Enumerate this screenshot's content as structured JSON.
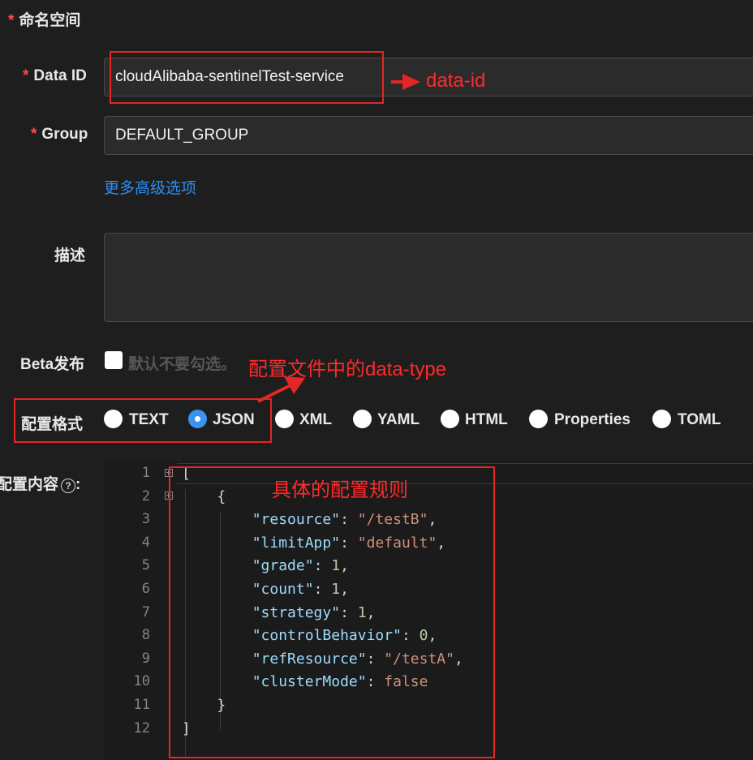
{
  "form": {
    "namespace": {
      "required": "*",
      "label": "命名空间"
    },
    "data_id": {
      "required": "*",
      "label": "Data ID",
      "value": "cloudAlibaba-sentinelTest-service"
    },
    "group": {
      "required": "*",
      "label": "Group",
      "value": "DEFAULT_GROUP"
    },
    "advanced_link": "更多高级选项",
    "description": {
      "label": "描述",
      "value": ""
    },
    "beta": {
      "label": "Beta发布",
      "hint": "默认不要勾选。",
      "checked": false
    },
    "format": {
      "label": "配置格式",
      "selected": "JSON",
      "options": [
        "TEXT",
        "JSON",
        "XML",
        "YAML",
        "HTML",
        "Properties",
        "TOML"
      ]
    },
    "content": {
      "label": "配置内容",
      "help_icon": "question-circle-icon",
      "colon": ":"
    }
  },
  "editor": {
    "line_numbers": [
      "1",
      "2",
      "3",
      "4",
      "5",
      "6",
      "7",
      "8",
      "9",
      "10",
      "11",
      "12"
    ],
    "lines": [
      {
        "indent": "",
        "parts": [
          {
            "t": "p",
            "v": "["
          }
        ]
      },
      {
        "indent": "    ",
        "parts": [
          {
            "t": "p",
            "v": "{"
          }
        ]
      },
      {
        "indent": "        ",
        "parts": [
          {
            "t": "k",
            "v": "\"resource\""
          },
          {
            "t": "p",
            "v": ": "
          },
          {
            "t": "s",
            "v": "\"/testB\""
          },
          {
            "t": "p",
            "v": ","
          }
        ]
      },
      {
        "indent": "        ",
        "parts": [
          {
            "t": "k",
            "v": "\"limitApp\""
          },
          {
            "t": "p",
            "v": ": "
          },
          {
            "t": "s",
            "v": "\"default\""
          },
          {
            "t": "p",
            "v": ","
          }
        ]
      },
      {
        "indent": "        ",
        "parts": [
          {
            "t": "k",
            "v": "\"grade\""
          },
          {
            "t": "p",
            "v": ": "
          },
          {
            "t": "n",
            "v": "1"
          },
          {
            "t": "p",
            "v": ","
          }
        ]
      },
      {
        "indent": "        ",
        "parts": [
          {
            "t": "k",
            "v": "\"count\""
          },
          {
            "t": "p",
            "v": ": "
          },
          {
            "t": "n",
            "v": "1"
          },
          {
            "t": "p",
            "v": ","
          }
        ]
      },
      {
        "indent": "        ",
        "parts": [
          {
            "t": "k",
            "v": "\"strategy\""
          },
          {
            "t": "p",
            "v": ": "
          },
          {
            "t": "n",
            "v": "1"
          },
          {
            "t": "p",
            "v": ","
          }
        ]
      },
      {
        "indent": "        ",
        "parts": [
          {
            "t": "k",
            "v": "\"controlBehavior\""
          },
          {
            "t": "p",
            "v": ": "
          },
          {
            "t": "n",
            "v": "0"
          },
          {
            "t": "p",
            "v": ","
          }
        ]
      },
      {
        "indent": "        ",
        "parts": [
          {
            "t": "k",
            "v": "\"refResource\""
          },
          {
            "t": "p",
            "v": ": "
          },
          {
            "t": "s",
            "v": "\"/testA\""
          },
          {
            "t": "p",
            "v": ","
          }
        ]
      },
      {
        "indent": "        ",
        "parts": [
          {
            "t": "k",
            "v": "\"clusterMode\""
          },
          {
            "t": "p",
            "v": ": "
          },
          {
            "t": "s",
            "v": "false"
          }
        ]
      },
      {
        "indent": "    ",
        "parts": [
          {
            "t": "p",
            "v": "}"
          }
        ]
      },
      {
        "indent": "",
        "parts": [
          {
            "t": "p",
            "v": "]"
          }
        ]
      }
    ]
  },
  "annotations": {
    "data_id_note": "data-id",
    "data_type_note": "配置文件中的data-type",
    "rules_note": "具体的配置规则"
  },
  "colors": {
    "annotation": "#ff2a2a",
    "link": "#2f8ef0",
    "radio_checked": "#3a93ee",
    "background": "#1e1e1e"
  }
}
